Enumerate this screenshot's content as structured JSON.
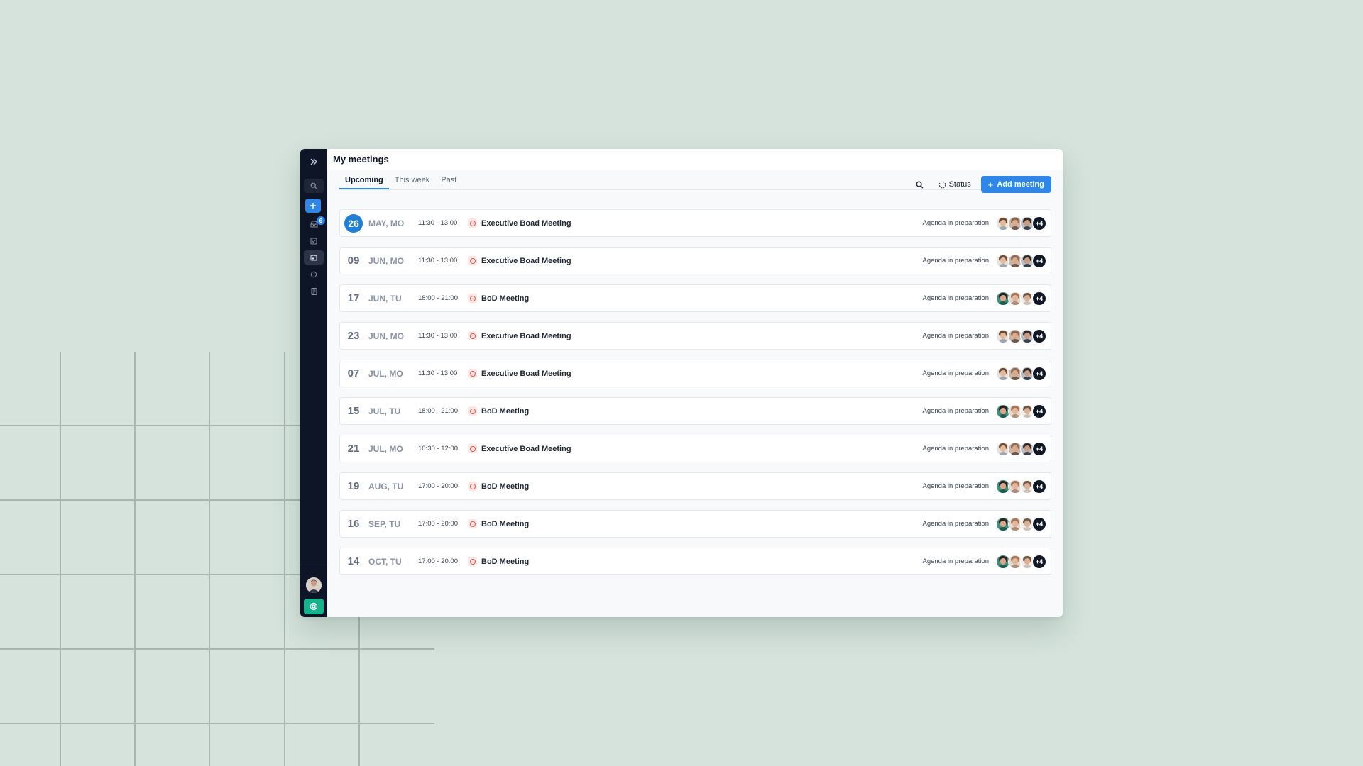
{
  "window": {
    "title": "My meetings"
  },
  "sidebar": {
    "notification_count": "6"
  },
  "tabs": [
    {
      "label": "Upcoming",
      "active": true
    },
    {
      "label": "This week",
      "active": false
    },
    {
      "label": "Past",
      "active": false
    }
  ],
  "toolbar": {
    "status_label": "Status",
    "add_label": "Add meeting"
  },
  "meetings": [
    {
      "day": "26",
      "month": "MAY, MO",
      "time": "11:30 - 13:00",
      "title": "Executive Boad Meeting",
      "status": "Agenda in preparation",
      "extra": "+4",
      "today": true,
      "group": "exec"
    },
    {
      "day": "09",
      "month": "JUN, MO",
      "time": "11:30 - 13:00",
      "title": "Executive Boad Meeting",
      "status": "Agenda in preparation",
      "extra": "+4",
      "today": false,
      "group": "exec"
    },
    {
      "day": "17",
      "month": "JUN, TU",
      "time": "18:00 - 21:00",
      "title": "BoD Meeting",
      "status": "Agenda in preparation",
      "extra": "+4",
      "today": false,
      "group": "bod"
    },
    {
      "day": "23",
      "month": "JUN, MO",
      "time": "11:30 - 13:00",
      "title": "Executive Boad Meeting",
      "status": "Agenda in preparation",
      "extra": "+4",
      "today": false,
      "group": "exec"
    },
    {
      "day": "07",
      "month": "JUL, MO",
      "time": "11:30 - 13:00",
      "title": "Executive Boad Meeting",
      "status": "Agenda in preparation",
      "extra": "+4",
      "today": false,
      "group": "exec"
    },
    {
      "day": "15",
      "month": "JUL, TU",
      "time": "18:00 - 21:00",
      "title": "BoD Meeting",
      "status": "Agenda in preparation",
      "extra": "+4",
      "today": false,
      "group": "bod"
    },
    {
      "day": "21",
      "month": "JUL, MO",
      "time": "10:30 - 12:00",
      "title": "Executive Boad Meeting",
      "status": "Agenda in preparation",
      "extra": "+4",
      "today": false,
      "group": "exec"
    },
    {
      "day": "19",
      "month": "AUG, TU",
      "time": "17:00 - 20:00",
      "title": "BoD Meeting",
      "status": "Agenda in preparation",
      "extra": "+4",
      "today": false,
      "group": "bod"
    },
    {
      "day": "16",
      "month": "SEP, TU",
      "time": "17:00 - 20:00",
      "title": "BoD Meeting",
      "status": "Agenda in preparation",
      "extra": "+4",
      "today": false,
      "group": "bod"
    },
    {
      "day": "14",
      "month": "OCT, TU",
      "time": "17:00 - 20:00",
      "title": "BoD Meeting",
      "status": "Agenda in preparation",
      "extra": "+4",
      "today": false,
      "group": "bod"
    }
  ],
  "colors": {
    "accent": "#2f86e6",
    "sidebar_bg": "#0e1526",
    "page_bg": "#d5e3dc",
    "meeting_icon": "#e2574c",
    "help_button": "#15b48a"
  },
  "icons": {
    "expand": "chevrons-right-icon",
    "search": "search-icon",
    "status": "dashed-circle-icon",
    "meeting": "circle-icon",
    "help": "lifebuoy-icon"
  }
}
